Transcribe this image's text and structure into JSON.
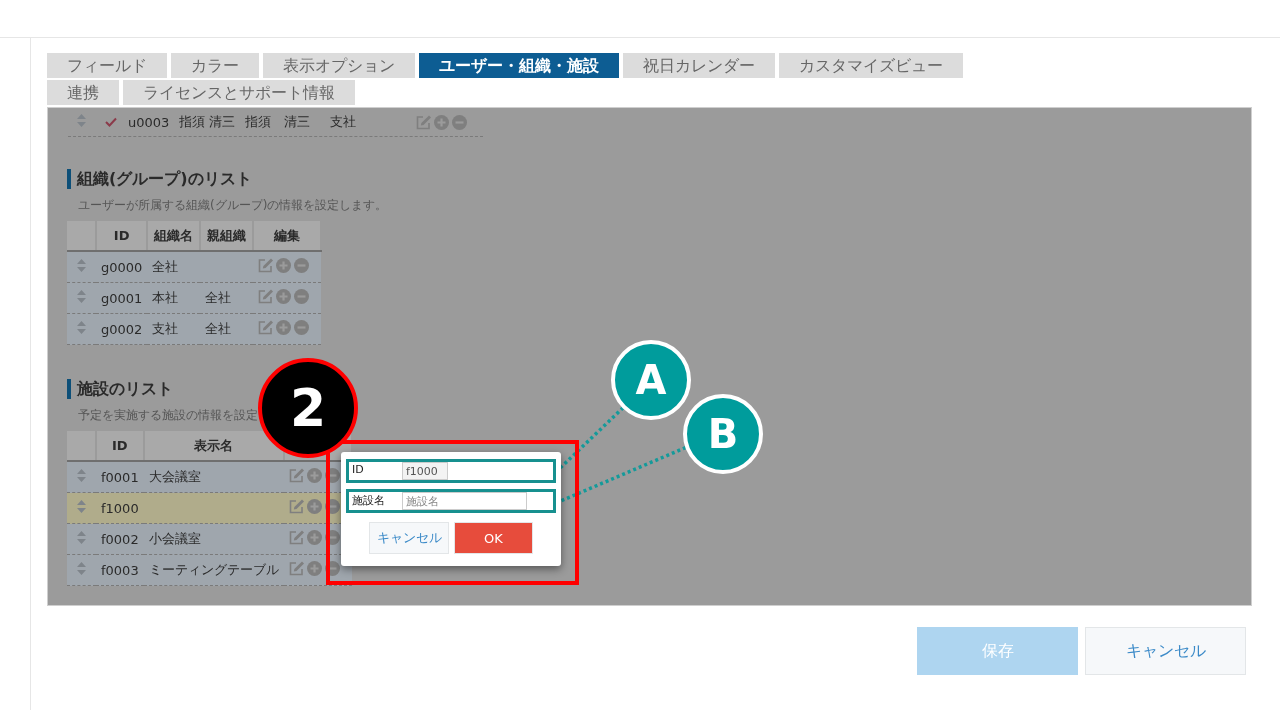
{
  "tabs": [
    {
      "label": "フィールド",
      "selected": false
    },
    {
      "label": "カラー",
      "selected": false
    },
    {
      "label": "表示オプション",
      "selected": false
    },
    {
      "label": "ユーザー・組織・施設",
      "selected": true
    },
    {
      "label": "祝日カレンダー",
      "selected": false
    },
    {
      "label": "カスタマイズビュー",
      "selected": false
    },
    {
      "label": "連携",
      "selected": false
    },
    {
      "label": "ライセンスとサポート情報",
      "selected": false
    }
  ],
  "user_row": {
    "checked": true,
    "cells": [
      "u0003",
      "指須 清三",
      "指須　清三",
      "支社"
    ]
  },
  "org_section": {
    "title": "組織(グループ)のリスト",
    "description": "ユーザーが所属する組織(グループ)の情報を設定します。",
    "columns": [
      "ID",
      "組織名",
      "親組織",
      "編集"
    ],
    "rows": [
      {
        "cells": [
          "g0000",
          "全社",
          ""
        ]
      },
      {
        "cells": [
          "g0001",
          "本社",
          "全社"
        ]
      },
      {
        "cells": [
          "g0002",
          "支社",
          "全社"
        ]
      }
    ]
  },
  "facility_section": {
    "title": "施設のリスト",
    "description": "予定を実施する施設の情報を設定",
    "columns": [
      "ID",
      "表示名"
    ],
    "rows": [
      {
        "id": "f0001",
        "name": "大会議室",
        "selected": false
      },
      {
        "id": "f1000",
        "name": "",
        "selected": true
      },
      {
        "id": "f0002",
        "name": "小会議室",
        "selected": false
      },
      {
        "id": "f0003",
        "name": "ミーティングテーブル",
        "selected": false
      }
    ]
  },
  "dialog": {
    "fields": [
      {
        "label": "ID",
        "value": "f1000",
        "kind": "value"
      },
      {
        "label": "施設名",
        "placeholder": "施設名",
        "kind": "placeholder"
      }
    ],
    "buttons": [
      {
        "label": "キャンセル",
        "kind": "secondary"
      },
      {
        "label": "OK",
        "kind": "primary"
      }
    ]
  },
  "step_badge": "2",
  "callouts": [
    "A",
    "B"
  ],
  "footer_buttons": [
    {
      "label": "保存",
      "kind": "primary",
      "disabled": true
    },
    {
      "label": "キャンセル",
      "kind": "secondary",
      "disabled": false
    }
  ]
}
